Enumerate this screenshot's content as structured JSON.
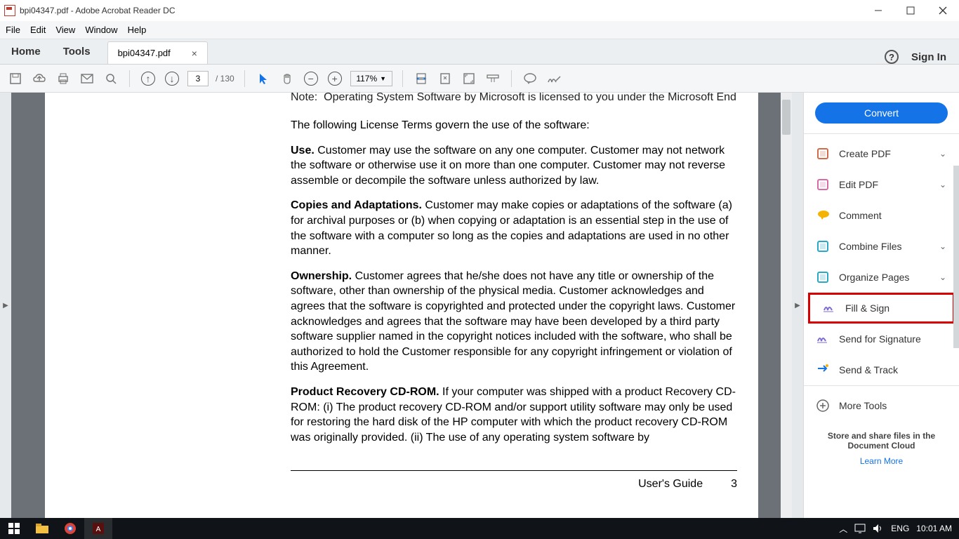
{
  "window": {
    "title": "bpi04347.pdf - Adobe Acrobat Reader DC"
  },
  "menubar": [
    "File",
    "Edit",
    "View",
    "Window",
    "Help"
  ],
  "tabs": {
    "home": "Home",
    "tools": "Tools",
    "doc": "bpi04347.pdf",
    "signin": "Sign In"
  },
  "toolbar": {
    "page_current": "3",
    "page_total": "/ 130",
    "zoom": "117%"
  },
  "doc": {
    "p0": "Note:  Operating System Software by Microsoft is licensed to you under the Microsoft End User License Agreement (EULA).",
    "p1": "The following License Terms govern the use of the software:",
    "p2a": "Use.",
    "p2b": "  Customer may use the software on any one computer. Customer may not network the software or otherwise use it on more than one computer. Customer may not reverse assemble or decompile the software unless authorized by law.",
    "p3a": "Copies and Adaptations.",
    "p3b": "  Customer may make copies or adaptations of the software (a) for archival purposes or (b) when copying or adaptation is an essential step in the use of the software with a computer so long as the copies and adaptations are used in no other manner.",
    "p4a": "Ownership.",
    "p4b": "  Customer agrees that he/she does not have any title or ownership of the software, other than ownership of the physical media. Customer acknowledges and agrees that the software is copyrighted and protected under the copyright laws. Customer acknowledges and agrees that the software may have been developed by a third party software supplier named in the copyright notices included with the software, who shall be authorized to hold the Customer responsible for any copyright infringement or violation of this Agreement.",
    "p5a": "Product Recovery CD-ROM.",
    "p5b": "  If your computer was shipped with a product Recovery CD-ROM: (i) The product recovery CD-ROM and/or support utility software may only be used for restoring the hard disk of the HP computer with which the product recovery CD-ROM was originally provided. (ii) The use of any operating system software by",
    "footer_label": "User's Guide",
    "footer_page": "3"
  },
  "side": {
    "convert": "Convert",
    "items": [
      {
        "label": "Create PDF",
        "chev": true,
        "color": "#d16b4a"
      },
      {
        "label": "Edit PDF",
        "chev": true,
        "color": "#d96aa8"
      },
      {
        "label": "Comment",
        "chev": false,
        "color": "#f5b301"
      },
      {
        "label": "Combine Files",
        "chev": true,
        "color": "#2aa8c9"
      },
      {
        "label": "Organize Pages",
        "chev": true,
        "color": "#2aa8c9"
      },
      {
        "label": "Fill & Sign",
        "chev": false,
        "color": "#7d6bd6",
        "hl": true
      },
      {
        "label": "Send for Signature",
        "chev": false,
        "color": "#7d6bd6"
      },
      {
        "label": "Send & Track",
        "chev": false,
        "color": "#1473e6"
      },
      {
        "label": "More Tools",
        "chev": false,
        "color": "#666"
      }
    ],
    "promo": "Store and share files in the Document Cloud",
    "learn": "Learn More"
  },
  "taskbar": {
    "lang": "ENG",
    "time": "10:01 AM"
  }
}
